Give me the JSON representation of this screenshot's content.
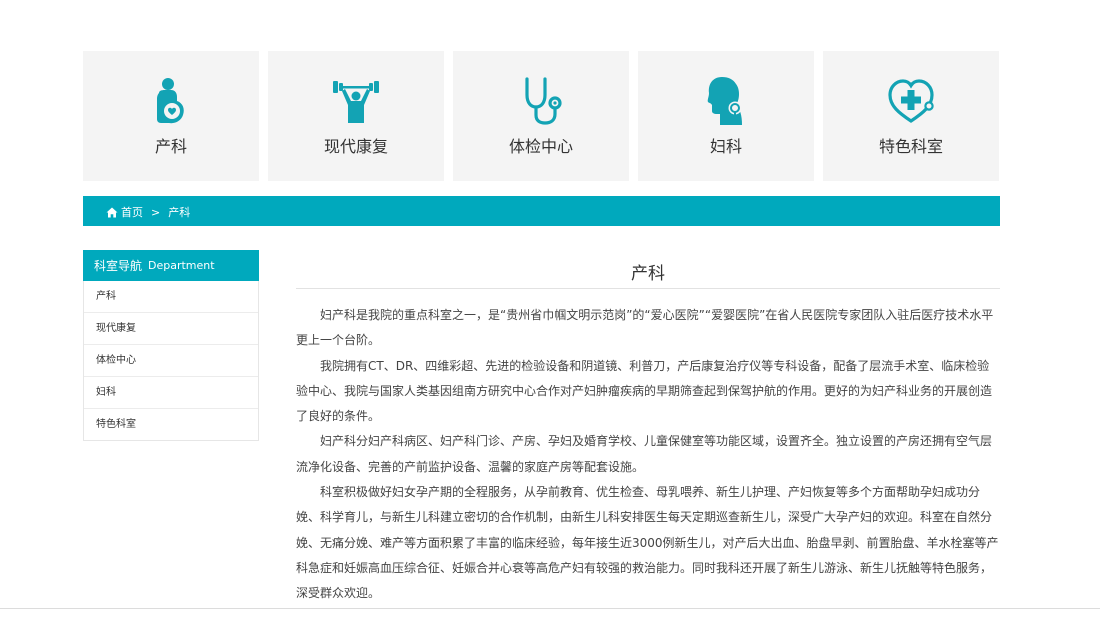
{
  "departments": [
    {
      "label": "产科",
      "icon": "pregnant-woman-icon"
    },
    {
      "label": "现代康复",
      "icon": "weightlifting-icon"
    },
    {
      "label": "体检中心",
      "icon": "stethoscope-icon"
    },
    {
      "label": "妇科",
      "icon": "woman-profile-icon"
    },
    {
      "label": "特色科室",
      "icon": "heart-plus-icon"
    }
  ],
  "breadcrumb": {
    "home": "首页",
    "separator": ">",
    "current": "产科"
  },
  "sidebar": {
    "title_cn": "科室导航",
    "title_en": "Department",
    "items": [
      "产科",
      "现代康复",
      "体检中心",
      "妇科",
      "特色科室"
    ]
  },
  "main": {
    "title": "产科",
    "paragraphs": [
      "妇产科是我院的重点科室之一，是“贵州省巾帼文明示范岗”的“爱心医院”“爱婴医院”在省人民医院专家团队入驻后医疗技术水平更上一个台阶。",
      "我院拥有CT、DR、四维彩超、先进的检验设备和阴道镜、利普刀，产后康复治疗仪等专科设备，配备了层流手术室、临床检验验中心、我院与国家人类基因组南方研究中心合作对产妇肿瘤疾病的早期筛查起到保驾护航的作用。更好的为妇产科业务的开展创造了良好的条件。",
      "妇产科分妇产科病区、妇产科门诊、产房、孕妇及婚育学校、儿童保健室等功能区域，设置齐全。独立设置的产房还拥有空气层流净化设备、完善的产前监护设备、温馨的家庭产房等配套设施。",
      "科室积极做好妇女孕产期的全程服务，从孕前教育、优生检查、母乳喂养、新生儿护理、产妇恢复等多个方面帮助孕妇成功分娩、科学育儿，与新生儿科建立密切的合作机制，由新生儿科安排医生每天定期巡查新生儿，深受广大孕产妇的欢迎。科室在自然分娩、无痛分娩、难产等方面积累了丰富的临床经验，每年接生近3000例新生儿，对产后大出血、胎盘早剥、前置胎盘、羊水栓塞等产科急症和妊娠高血压综合征、妊娠合并心衰等高危产妇有较强的救治能力。同时我科还开展了新生儿游泳、新生儿抚触等特色服务，深受群众欢迎。"
    ]
  },
  "colors": {
    "accent": "#00a9bd",
    "card_bg": "#f4f4f4",
    "icon": "#13a3b4"
  }
}
